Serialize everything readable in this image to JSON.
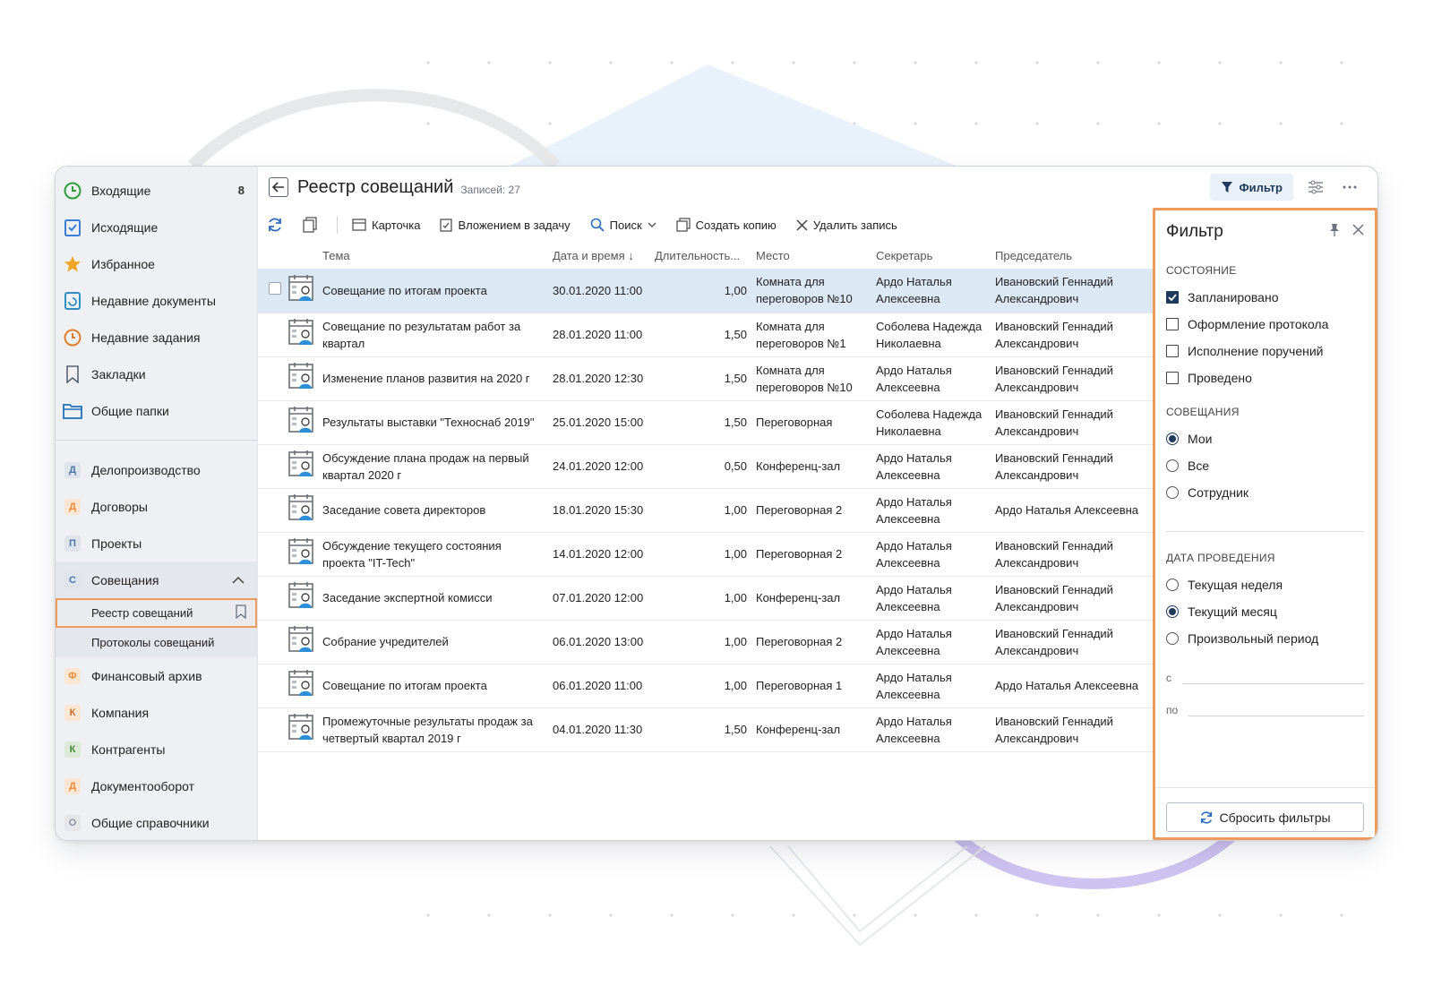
{
  "sidebar": {
    "top_items": [
      {
        "label": "Входящие",
        "badge": "8",
        "icon": "clock-icon"
      },
      {
        "label": "Исходящие",
        "icon": "checklist-icon"
      },
      {
        "label": "Избранное",
        "icon": "star-icon"
      },
      {
        "label": "Недавние документы",
        "icon": "recent-doc-icon"
      },
      {
        "label": "Недавние задания",
        "icon": "recent-task-icon"
      },
      {
        "label": "Закладки",
        "icon": "bookmark-icon"
      },
      {
        "label": "Общие папки",
        "icon": "folder-icon"
      }
    ],
    "modules": [
      {
        "letter": "Д",
        "label": "Делопроизводство"
      },
      {
        "letter": "Д",
        "label": "Договоры"
      },
      {
        "letter": "П",
        "label": "Проекты"
      },
      {
        "letter": "С",
        "label": "Совещания"
      },
      {
        "letter": "Ф",
        "label": "Финансовый архив"
      },
      {
        "letter": "К",
        "label": "Компания"
      },
      {
        "letter": "К",
        "label": "Контрагенты"
      },
      {
        "letter": "Д",
        "label": "Документооборот"
      },
      {
        "letter": "О",
        "label": "Общие справочники"
      }
    ],
    "sub_items": [
      "Реестр совещаний",
      "Протоколы совещаний"
    ]
  },
  "header": {
    "title": "Реестр совещаний",
    "records": "Записей: 27",
    "filter_label": "Фильтр"
  },
  "toolbar": {
    "card": "Карточка",
    "attach_task": "Вложением в задачу",
    "search": "Поиск",
    "copy": "Создать копию",
    "delete": "Удалить запись"
  },
  "table": {
    "columns": [
      "Тема",
      "Дата и время ↓",
      "Длительность...",
      "Место",
      "Секретарь",
      "Председатель"
    ],
    "rows": [
      {
        "topic": "Совещание по итогам проекта",
        "date": "30.01.2020 11:00",
        "dur": "1,00",
        "place": "Комната для переговоров №10",
        "secretary": "Ардо Наталья Алексеевна",
        "chair": "Ивановский Геннадий Александрович"
      },
      {
        "topic": "Совещание по результатам работ за квартал",
        "date": "28.01.2020 11:00",
        "dur": "1,50",
        "place": "Комната для переговоров №1",
        "secretary": "Соболева Надежда Николаевна",
        "chair": "Ивановский Геннадий Александрович"
      },
      {
        "topic": "Изменение планов развития на 2020 г",
        "date": "28.01.2020 12:30",
        "dur": "1,50",
        "place": "Комната для переговоров №10",
        "secretary": "Ардо Наталья Алексеевна",
        "chair": "Ивановский Геннадий Александрович"
      },
      {
        "topic": "Результаты выставки \"Техноснаб 2019\"",
        "date": "25.01.2020 15:00",
        "dur": "1,50",
        "place": "Переговорная",
        "secretary": "Соболева Надежда Николаевна",
        "chair": "Ивановский Геннадий Александрович"
      },
      {
        "topic": "Обсуждение плана продаж на первый квартал 2020 г",
        "date": "24.01.2020 12:00",
        "dur": "0,50",
        "place": "Конференц-зал",
        "secretary": "Ардо Наталья Алексеевна",
        "chair": "Ивановский Геннадий Александрович"
      },
      {
        "topic": "Заседание совета директоров",
        "date": "18.01.2020 15:30",
        "dur": "1,00",
        "place": "Переговорная 2",
        "secretary": "Ардо Наталья Алексеевна",
        "chair": "Ардо Наталья Алексеевна"
      },
      {
        "topic": "Обсуждение текущего состояния проекта \"IT-Tech\"",
        "date": "14.01.2020 12:00",
        "dur": "1,00",
        "place": "Переговорная 2",
        "secretary": "Ардо Наталья Алексеевна",
        "chair": "Ивановский Геннадий Александрович"
      },
      {
        "topic": "Заседание экспертной комисси",
        "date": "07.01.2020 12:00",
        "dur": "1,00",
        "place": "Конференц-зал",
        "secretary": "Ардо Наталья Алексеевна",
        "chair": "Ивановский Геннадий Александрович"
      },
      {
        "topic": "Собрание учредителей",
        "date": "06.01.2020 13:00",
        "dur": "1,00",
        "place": "Переговорная 2",
        "secretary": "Ардо Наталья Алексеевна",
        "chair": "Ивановский Геннадий Александрович"
      },
      {
        "topic": "Совещание по итогам проекта",
        "date": "06.01.2020 11:00",
        "dur": "1,00",
        "place": "Переговорная 1",
        "secretary": "Ардо Наталья Алексеевна",
        "chair": "Ардо Наталья Алексеевна"
      },
      {
        "topic": "Промежуточные результаты продаж за четвертый квартал 2019 г",
        "date": "04.01.2020 11:30",
        "dur": "1,50",
        "place": "Конференц-зал",
        "secretary": "Ардо Наталья Алексеевна",
        "chair": "Ивановский Геннадий Александрович"
      }
    ]
  },
  "filter": {
    "title": "Фильтр",
    "state_section": "СОСТОЯНИЕ",
    "state_options": [
      {
        "label": "Запланировано",
        "checked": true
      },
      {
        "label": "Оформление протокола",
        "checked": false
      },
      {
        "label": "Исполнение поручений",
        "checked": false
      },
      {
        "label": "Проведено",
        "checked": false
      }
    ],
    "meetings_section": "СОВЕЩАНИЯ",
    "meetings_options": [
      {
        "label": "Мои",
        "checked": true
      },
      {
        "label": "Все",
        "checked": false
      },
      {
        "label": "Сотрудник",
        "checked": false
      }
    ],
    "date_section": "ДАТА ПРОВЕДЕНИЯ",
    "date_options": [
      {
        "label": "Текущая неделя",
        "checked": false
      },
      {
        "label": "Текущий месяц",
        "checked": true
      },
      {
        "label": "Произвольный период",
        "checked": false
      }
    ],
    "from_label": "с",
    "to_label": "по",
    "reset_label": "Сбросить фильтры"
  },
  "colors": {
    "accent": "#1f3a5c",
    "highlight": "#ee9a5a",
    "selected_row": "#dde8f5"
  }
}
